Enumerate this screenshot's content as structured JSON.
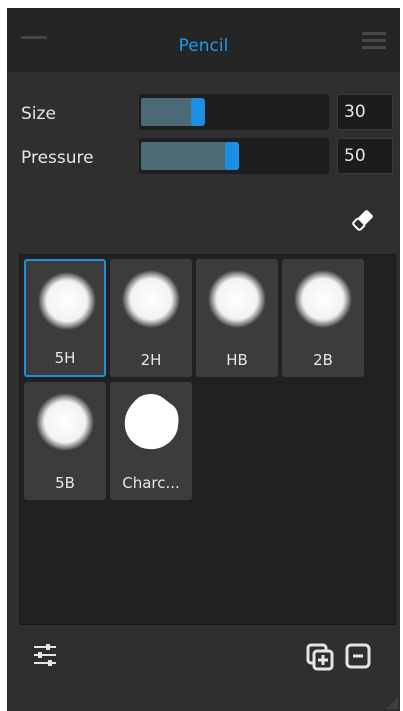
{
  "header": {
    "title": "Pencil"
  },
  "controls": {
    "size": {
      "label": "Size",
      "value": "30",
      "fill_fraction": 0.3
    },
    "pressure": {
      "label": "Pressure",
      "value": "50",
      "fill_fraction": 0.5
    }
  },
  "presets": [
    {
      "name": "5H",
      "selected": true
    },
    {
      "name": "2H",
      "selected": false
    },
    {
      "name": "HB",
      "selected": false
    },
    {
      "name": "2B",
      "selected": false
    },
    {
      "name": "5B",
      "selected": false
    },
    {
      "name": "Charc...",
      "selected": false
    }
  ],
  "icons": {
    "minimize": "minus-icon",
    "menu": "hamburger-menu-icon",
    "eraser": "eraser-icon",
    "settings": "sliders-icon",
    "duplicate": "duplicate-preset-icon",
    "remove": "remove-preset-icon"
  },
  "colors": {
    "accent": "#1a9bf0",
    "panel": "#2f2f2f"
  }
}
